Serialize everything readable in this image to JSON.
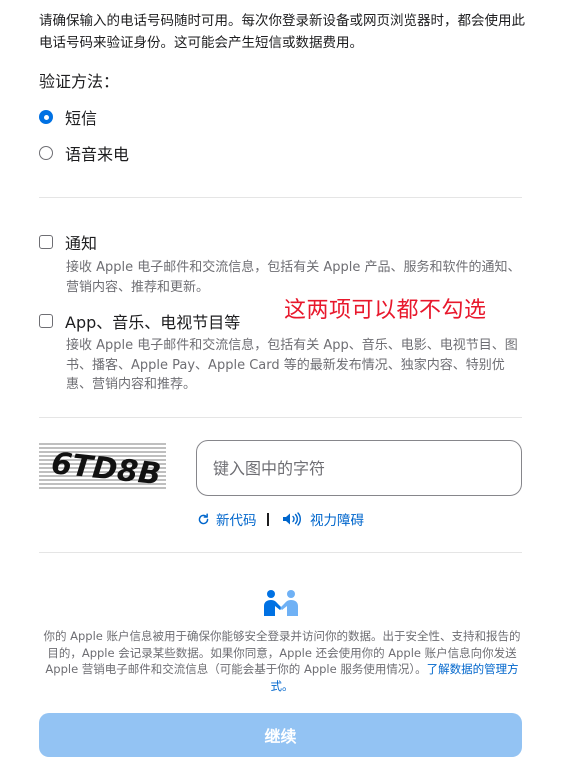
{
  "intro_text": "请确保输入的电话号码随时可用。每次你登录新设备或网页浏览器时，都会使用此电话号码来验证身份。这可能会产生短信或数据费用。",
  "verification": {
    "title": "验证方法：",
    "options": [
      {
        "label": "短信",
        "selected": true
      },
      {
        "label": "语音来电",
        "selected": false
      }
    ]
  },
  "subscriptions": [
    {
      "label": "通知",
      "checked": false,
      "description": "接收 Apple 电子邮件和交流信息，包括有关 Apple 产品、服务和软件的通知、营销内容、推荐和更新。"
    },
    {
      "label": "App、音乐、电视节目等",
      "checked": false,
      "description": "接收 Apple 电子邮件和交流信息，包括有关 App、音乐、电影、电视节目、图书、播客、Apple Pay、Apple Card 等的最新发布情况、独家内容、特别优惠、营销内容和推荐。"
    }
  ],
  "annotation": "这两项可以都不勾选",
  "captcha": {
    "image_text": "6TD8B",
    "placeholder": "键入图中的字符",
    "new_code_label": "新代码",
    "accessibility_label": "视力障碍"
  },
  "privacy": {
    "text": "你的 Apple 账户信息被用于确保你能够安全登录并访问你的数据。出于安全性、支持和报告的目的，Apple 会记录某些数据。如果你同意，Apple 还会使用你的 Apple 账户信息向你发送 Apple 营销电子邮件和交流信息（可能会基于你的 Apple 服务使用情况）。",
    "link_text": "了解数据的管理方式。"
  },
  "continue_label": "继续",
  "colors": {
    "accent": "#0071e3",
    "link": "#0066cc",
    "annotation": "#e8182c",
    "button_disabled": "#93c3f3"
  },
  "icons": {
    "refresh": "refresh-icon",
    "speaker": "speaker-icon",
    "privacy": "handshake-people-icon"
  }
}
